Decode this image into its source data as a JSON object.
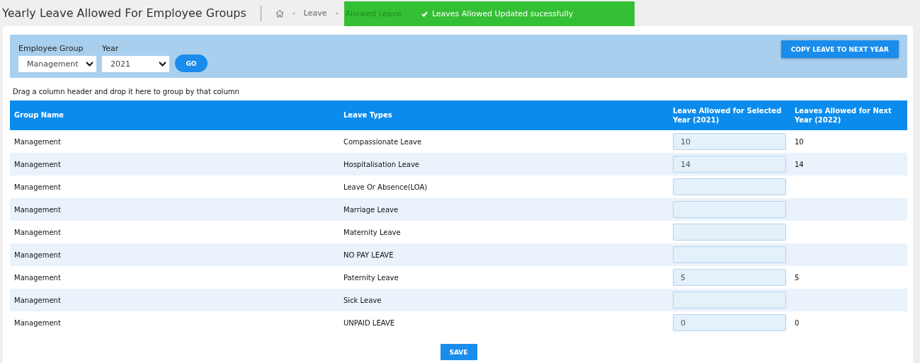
{
  "header": {
    "title": "Yearly Leave Allowed For Employee Groups",
    "breadcrumb": [
      "Leave",
      "Allowed Leave"
    ]
  },
  "toast": {
    "message": "Leaves Allowed Updated sucessfully"
  },
  "filters": {
    "group_label": "Employee Group",
    "group_value": "Management",
    "year_label": "Year",
    "year_value": "2021",
    "go": "GO",
    "copy": "COPY LEAVE TO NEXT YEAR"
  },
  "group_hint": "Drag a column header and drop it here to group by that column",
  "table": {
    "columns": [
      "Group Name",
      "Leave Types",
      "Leave Allowed for Selected Year (2021)",
      "Leaves Allowed for Next Year (2022)"
    ],
    "rows": [
      {
        "group": "Management",
        "type": "Compassionate Leave",
        "allowed": "10",
        "next": "10"
      },
      {
        "group": "Management",
        "type": "Hospitalisation Leave",
        "allowed": "14",
        "next": "14"
      },
      {
        "group": "Management",
        "type": "Leave Or Absence(LOA)",
        "allowed": "",
        "next": ""
      },
      {
        "group": "Management",
        "type": "Marriage Leave",
        "allowed": "",
        "next": ""
      },
      {
        "group": "Management",
        "type": "Maternity Leave",
        "allowed": "",
        "next": ""
      },
      {
        "group": "Management",
        "type": "NO PAY LEAVE",
        "allowed": "",
        "next": ""
      },
      {
        "group": "Management",
        "type": "Paternity Leave",
        "allowed": "5",
        "next": "5"
      },
      {
        "group": "Management",
        "type": "Sick Leave",
        "allowed": "",
        "next": ""
      },
      {
        "group": "Management",
        "type": "UNPAID LEAVE",
        "allowed": "0",
        "next": "0"
      }
    ]
  },
  "save": "SAVE"
}
